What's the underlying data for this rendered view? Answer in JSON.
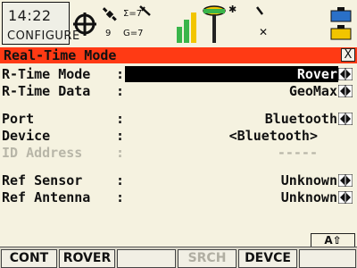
{
  "status_bar": {
    "time": "14:22",
    "app_label": "CONFIGURE",
    "sat_counts": {
      "primary": "9",
      "sum": "Σ=7",
      "glonass": "G=7"
    }
  },
  "title_bar": {
    "title": "Real-Time Mode",
    "close_label": "X"
  },
  "fields": [
    {
      "label": "R-Time Mode",
      "separator": ":",
      "value": "Rover",
      "arrows": true,
      "selected": true,
      "disabled": false
    },
    {
      "label": "R-Time Data",
      "separator": ":",
      "value": "GeoMax",
      "arrows": true,
      "selected": false,
      "disabled": false
    },
    {
      "label": "Port",
      "separator": ":",
      "value": "Bluetooth",
      "arrows": true,
      "selected": false,
      "disabled": false
    },
    {
      "label": "Device",
      "separator": ":",
      "value": "<Bluetooth>",
      "arrows": false,
      "selected": false,
      "disabled": false
    },
    {
      "label": "ID Address",
      "separator": ":",
      "value": "-----",
      "arrows": false,
      "selected": false,
      "disabled": true
    },
    {
      "label": "Ref Sensor",
      "separator": ":",
      "value": "Unknown",
      "arrows": true,
      "selected": false,
      "disabled": false
    },
    {
      "label": "Ref Antenna",
      "separator": ":",
      "value": "Unknown",
      "arrows": true,
      "selected": false,
      "disabled": false
    }
  ],
  "shift_indicator": "A⇧",
  "softkeys": [
    {
      "label": "CONT",
      "enabled": true
    },
    {
      "label": "ROVER",
      "enabled": true
    },
    {
      "label": "",
      "enabled": false
    },
    {
      "label": "SRCH",
      "enabled": false
    },
    {
      "label": "DEVCE",
      "enabled": true
    },
    {
      "label": "",
      "enabled": false
    }
  ],
  "colors": {
    "title_bar": "#ff3a14",
    "background": "#f5f2e0",
    "selection": "#000000"
  }
}
